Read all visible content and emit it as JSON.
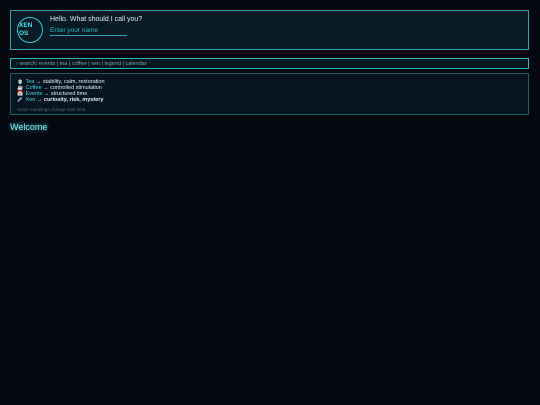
{
  "header": {
    "logo_text": "XEN\nOS",
    "greeting": "Hello. What should I call you?",
    "name_placeholder": "Enter your name",
    "name_value": ""
  },
  "search": {
    "text": "› search: events | tea | coffee | xen | legend | calendar"
  },
  "legend": {
    "items": [
      {
        "icon": "teacup-icon",
        "glyph": "🍵",
        "keyword": "Tea",
        "arrow": "→",
        "description": "stability, calm, restoration"
      },
      {
        "icon": "coffee-icon",
        "glyph": "☕",
        "keyword": "Coffee",
        "arrow": "→",
        "description": "controlled stimulation"
      },
      {
        "icon": "calendar-icon",
        "glyph": "📅",
        "keyword": "Events",
        "arrow": "→",
        "description": "structured time"
      },
      {
        "icon": "syringe-icon",
        "glyph": "💉",
        "keyword": "Xen",
        "arrow": "→",
        "description": "curiosity, risk, mystery"
      }
    ],
    "note": "Some meanings change over time."
  },
  "welcome": "Welcome",
  "colors": {
    "background": "#05080f",
    "accent": "#2bc9d0",
    "border": "#2aa3a8"
  }
}
